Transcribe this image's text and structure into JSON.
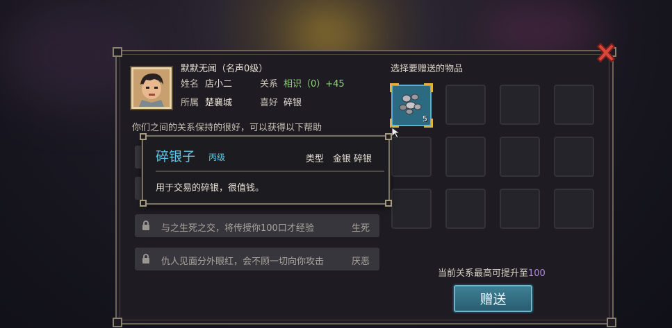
{
  "npc": {
    "title": "默默无闻（名声0级）",
    "name_label": "姓名",
    "name": "店小二",
    "relation_label": "关系",
    "relation_value": "相识（0）+45",
    "faction_label": "所属",
    "faction": "楚襄城",
    "hobby_label": "喜好",
    "hobby": "碎银"
  },
  "help_intro": "你们之间的关系保持的很好，可以获得以下帮助",
  "benefits": [
    {
      "desc": "与之生死之交，将传授你100口才经验",
      "tag": "生死"
    },
    {
      "desc": "仇人见面分外眼红，会不顾一切向你攻击",
      "tag": "厌恶"
    }
  ],
  "tooltip": {
    "name": "碎银子",
    "grade": "丙级",
    "type": "类型　金银 碎银",
    "desc": "用于交易的碎银，很值钱。"
  },
  "gift_panel": {
    "title": "选择要赠送的物品",
    "item": {
      "name": "碎银子",
      "count": "5"
    },
    "max_text": "当前关系最高可提升至",
    "max_value": "100",
    "button": "赠送"
  },
  "icons": {
    "close": "close-x-icon",
    "lock": "lock-icon",
    "item": "silver-pieces-icon",
    "cursor": "mouse-pointer-icon"
  },
  "colors": {
    "accent_blue": "#5ec8ea",
    "relation_green": "#8fd07a",
    "value_purple": "#b48be0",
    "close_red": "#d8473c"
  }
}
